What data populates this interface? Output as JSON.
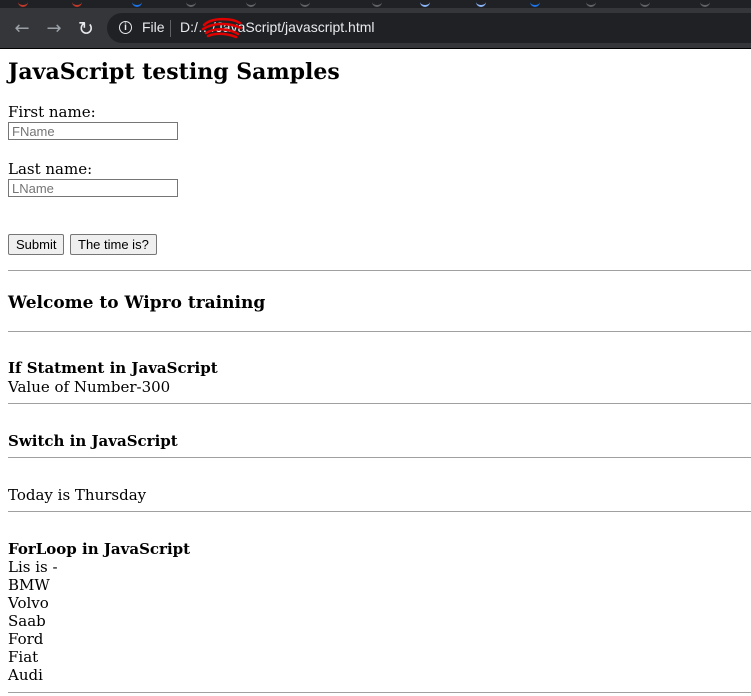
{
  "browser": {
    "scheme_label": "File",
    "url": "D:/…/JavaScript/javascript.html",
    "back_glyph": "←",
    "forward_glyph": "→",
    "reload_glyph": "↻",
    "info_glyph": "i"
  },
  "page": {
    "title": "JavaScript testing Samples",
    "form": {
      "first_name_label": "First name:",
      "first_name_placeholder": "FName",
      "last_name_label": "Last name:",
      "last_name_placeholder": "LName",
      "submit_label": "Submit",
      "time_label": "The time is?"
    },
    "welcome_heading": "Welcome to Wipro training",
    "if_section": {
      "heading": "If Statment in JavaScript",
      "text": "Value of Number-300"
    },
    "switch_section": {
      "heading": "Switch in JavaScript",
      "text": "Today is Thursday"
    },
    "forloop_section": {
      "heading": "ForLoop in JavaScript",
      "intro": "Lis is -",
      "items": [
        "BMW",
        "Volvo",
        "Saab",
        "Ford",
        "Fiat",
        "Audi"
      ]
    }
  },
  "colors": {
    "chrome_bg": "#35363a",
    "omnibox_bg": "#202124",
    "redaction": "#e00000"
  }
}
